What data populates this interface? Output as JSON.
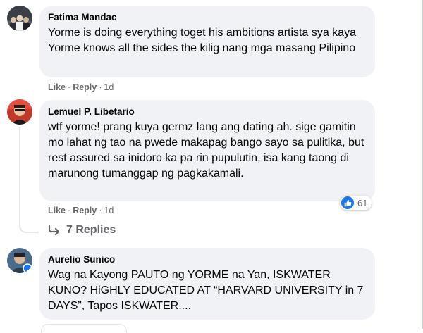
{
  "comments": [
    {
      "author": "Fatima Mandac",
      "text": "Yorme is doing everything toget his ambitions artista sya kaya Yorme knows all the sides the kilig nang mga masang Pilipino",
      "actions": {
        "like": "Like",
        "reply": "Reply",
        "time": "1d"
      }
    },
    {
      "author": "Lemuel P. Libetario",
      "text": "wtf yorme! prang kuya germz lang ang dating ah. sige gamitin mo lahat ng tao na pwede makapag bango sayo sa pulitika, but rest assured sa inidoro ka pa rin pupulutin, isa kang taong di marunong tumanggap ng pagkakamali.",
      "actions": {
        "like": "Like",
        "reply": "Reply",
        "time": "1d"
      },
      "reactions": {
        "count": "61",
        "icon": "thumbs-up-icon",
        "color": "#1877f2"
      },
      "replies_label": "7 Replies"
    },
    {
      "author": "Aurelio Sunico",
      "text": "Wag na Kayong PAUTO ng YORME na Yan, ISKWATER KUNO? HiGHLY EDUCATED AT “HARVARD UNIVERSITY in 7 DAYS”, Tapos ISKWATER...."
    }
  ]
}
